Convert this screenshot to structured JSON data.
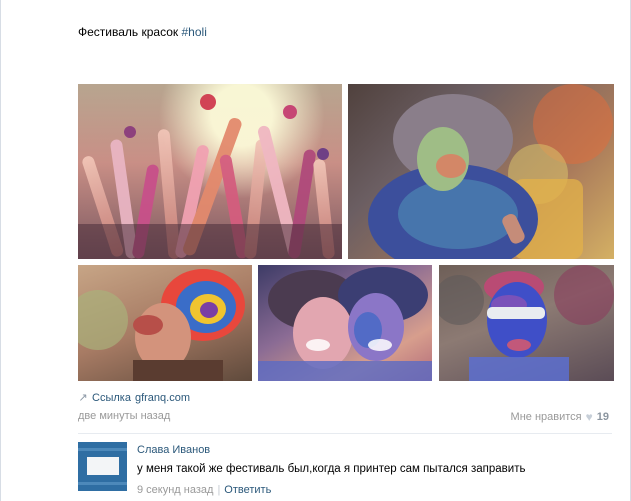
{
  "post": {
    "text": "Фестиваль красок",
    "hashtag": "#holi"
  },
  "photos": [
    {
      "description": "raised-hands-photo"
    },
    {
      "description": "girl-in-colors-photo"
    },
    {
      "description": "rainbow-hair-photo"
    },
    {
      "description": "couple-photo"
    },
    {
      "description": "man-with-glasses-photo"
    }
  ],
  "link": {
    "prefix": "Ссылка",
    "domain": "gfranq.com",
    "icon": "link-icon"
  },
  "meta": {
    "time": "две минуты назад",
    "like_label": "Мне нравится",
    "like_icon": "heart-icon",
    "like_count": "19"
  },
  "comment": {
    "author": "Слава Иванов",
    "text": "у меня такой же фестиваль был,когда я принтер сам пытался заправить",
    "time": "9 секунд назад",
    "reply_label": "Ответить"
  },
  "colors": {
    "link": "#2b587a",
    "muted": "#999999",
    "divider": "#e7ebf0"
  }
}
